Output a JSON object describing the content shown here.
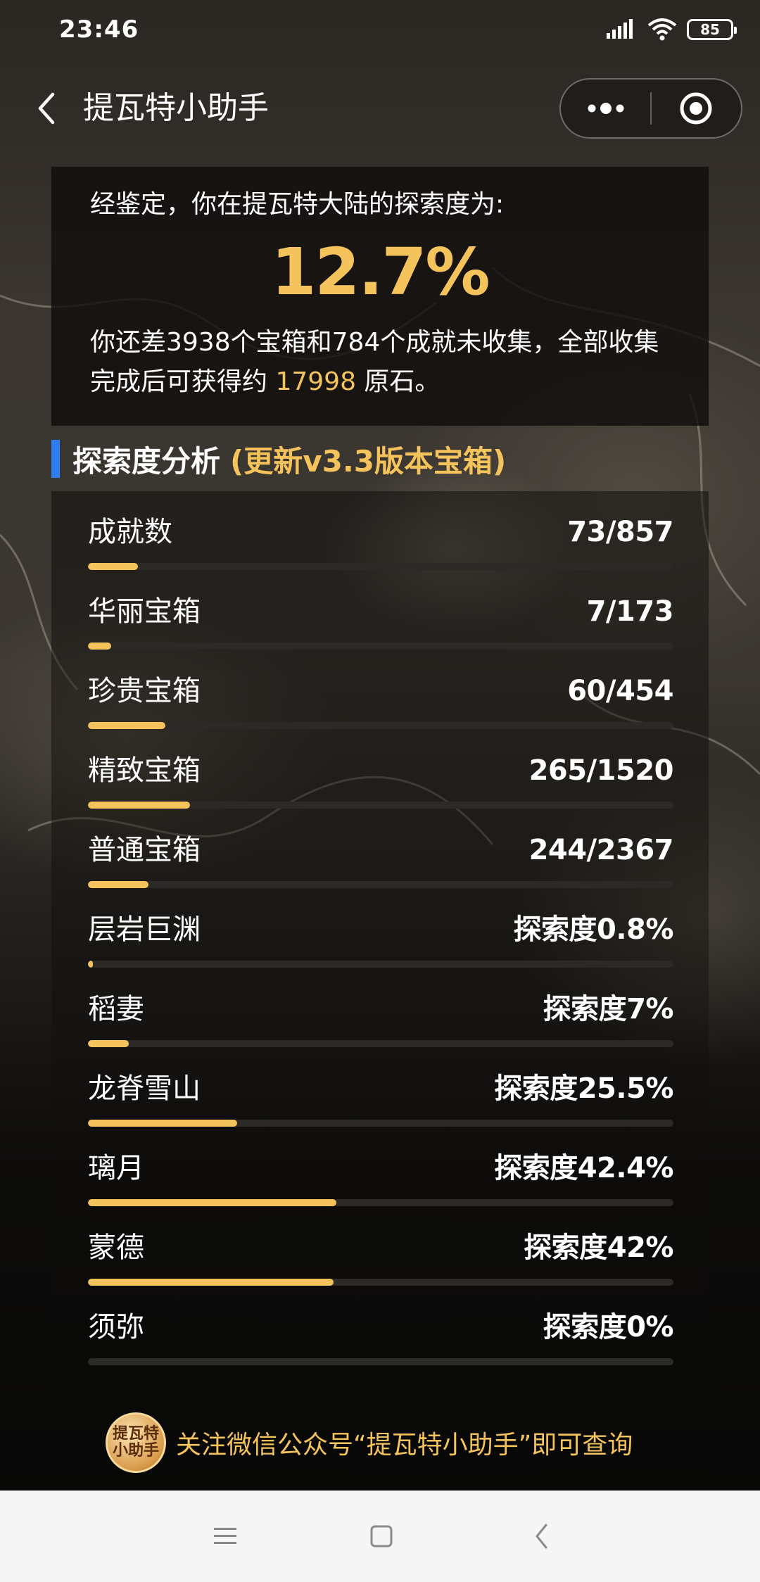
{
  "status_bar": {
    "time": "23:46",
    "battery": "85"
  },
  "nav": {
    "title": "提瓦特小助手"
  },
  "summary": {
    "intro": "经鉴定，你在提瓦特大陆的探索度为:",
    "percent": "12.7%",
    "text_before": "你还差3938个宝箱和784个成就未收集，全部收集完成后可获得约 ",
    "primogems": "17998",
    "text_after": " 原石。"
  },
  "section": {
    "title": "探索度分析",
    "subtitle": "(更新v3.3版本宝箱)"
  },
  "stats": [
    {
      "label": "成就数",
      "value": "73/857",
      "progress": 0.085
    },
    {
      "label": "华丽宝箱",
      "value": "7/173",
      "progress": 0.04
    },
    {
      "label": "珍贵宝箱",
      "value": "60/454",
      "progress": 0.132
    },
    {
      "label": "精致宝箱",
      "value": "265/1520",
      "progress": 0.174
    },
    {
      "label": "普通宝箱",
      "value": "244/2367",
      "progress": 0.103
    },
    {
      "label": "层岩巨渊",
      "value": "探索度0.8%",
      "progress": 0.008
    },
    {
      "label": "稻妻",
      "value": "探索度7%",
      "progress": 0.07
    },
    {
      "label": "龙脊雪山",
      "value": "探索度25.5%",
      "progress": 0.255
    },
    {
      "label": "璃月",
      "value": "探索度42.4%",
      "progress": 0.424
    },
    {
      "label": "蒙德",
      "value": "探索度42%",
      "progress": 0.42
    },
    {
      "label": "须弥",
      "value": "探索度0%",
      "progress": 0
    }
  ],
  "footer": {
    "avatar_text": "提瓦特小助手",
    "promo": "关注微信公众号“提瓦特小助手”即可查询"
  },
  "colors": {
    "accent": "#f5c35b",
    "section_marker": "#2d7ef5"
  },
  "icons": {
    "back": "chevron-left-icon",
    "more": "more-dots-icon",
    "close": "target-circle-icon",
    "menu": "menu-lines-icon",
    "home": "square-icon",
    "sys_back": "chevron-left-icon"
  }
}
